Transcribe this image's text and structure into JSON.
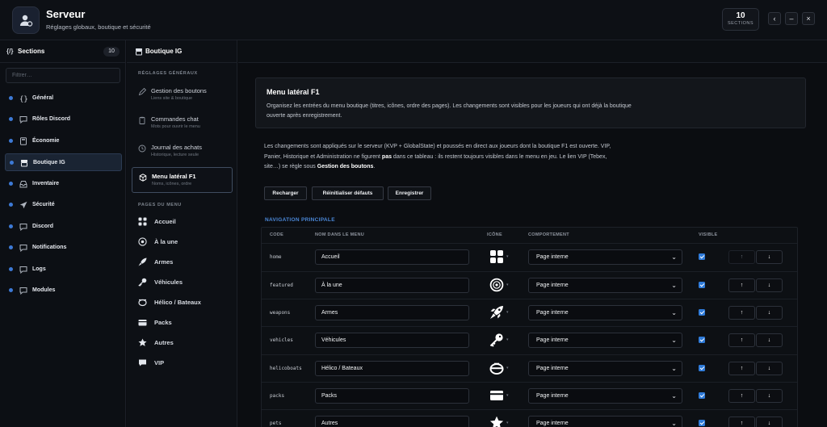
{
  "header": {
    "title": "Serveur",
    "subtitle": "Réglages globaux, boutique et sécurité",
    "count": "10",
    "count_label": "SECTIONS",
    "back_glyph": "‹",
    "minimize_glyph": "–",
    "close_glyph": "×"
  },
  "sidebar": {
    "title": "Sections",
    "badge": "10",
    "filter_placeholder": "Filtrer…",
    "items": [
      {
        "label": "Général",
        "icon": "braces-icon"
      },
      {
        "label": "Rôles Discord",
        "icon": "chat-icon"
      },
      {
        "label": "Économie",
        "icon": "calculator-icon"
      },
      {
        "label": "Boutique IG",
        "icon": "shop-icon"
      },
      {
        "label": "Inventaire",
        "icon": "inbox-icon"
      },
      {
        "label": "Sécurité",
        "icon": "send-icon"
      },
      {
        "label": "Discord",
        "icon": "chat-icon"
      },
      {
        "label": "Notifications",
        "icon": "chat-icon"
      },
      {
        "label": "Logs",
        "icon": "chat-icon"
      },
      {
        "label": "Modules",
        "icon": "chat-icon"
      }
    ],
    "active_index": 3
  },
  "subnav": {
    "title": "Boutique IG",
    "section_general": "RÉGLAGES GÉNÉRAUX",
    "items": [
      {
        "title": "Gestion des boutons",
        "sub": "Liens site & boutique"
      },
      {
        "title": "Commandes chat",
        "sub": "Mots pour ouvrir le menu"
      },
      {
        "title": "Journal des achats",
        "sub": "Historique, lecture seule"
      },
      {
        "title": "Menu latéral F1",
        "sub": "Noms, icônes, ordre"
      }
    ],
    "section_pages": "PAGES DU MENU",
    "pages": [
      {
        "label": "Accueil"
      },
      {
        "label": "À la une"
      },
      {
        "label": "Armes"
      },
      {
        "label": "Véhicules"
      },
      {
        "label": "Hélico / Bateaux"
      },
      {
        "label": "Packs"
      },
      {
        "label": "Autres"
      },
      {
        "label": "VIP"
      }
    ]
  },
  "main": {
    "panel_title": "Menu latéral F1",
    "panel_desc": "Organisez les entrées du menu boutique (titres, icônes, ordre des pages). Les changements sont visibles pour les joueurs qui ont déjà la boutique ouverte après enregistrement.",
    "info_1": "Les changements sont appliqués sur le serveur (KVP + GlobalState) et poussés en direct aux joueurs dont la boutique F1 est ouverte. VIP, Panier, Historique et Administration ne figurent ",
    "info_bold_1": "pas",
    "info_2": " dans ce tableau : ils restent toujours visibles dans le menu en jeu. Le lien VIP (Tebex, site…) se règle sous ",
    "info_bold_2": "Gestion des boutons",
    "info_3": ".",
    "buttons": {
      "reload": "Recharger",
      "reset": "Réinitialiser défauts",
      "save": "Enregistrer"
    },
    "nav_title": "NAVIGATION PRINCIPALE",
    "columns": {
      "code": "CODE",
      "name": "NOM DANS LE MENU",
      "icon": "ICÔNE",
      "behavior": "COMPORTEMENT",
      "visible": "VISIBLE"
    },
    "up_glyph": "↑",
    "down_glyph": "↓",
    "rows": [
      {
        "code": "home",
        "name": "Accueil",
        "icon": "grid-icon",
        "behavior": "Page interne",
        "visible": true
      },
      {
        "code": "featured",
        "name": "À la une",
        "icon": "star-circle-icon",
        "behavior": "Page interne",
        "visible": true
      },
      {
        "code": "weapons",
        "name": "Armes",
        "icon": "rocket-icon",
        "behavior": "Page interne",
        "visible": true
      },
      {
        "code": "vehicles",
        "name": "Véhicules",
        "icon": "key-icon",
        "behavior": "Page interne",
        "visible": true
      },
      {
        "code": "helicoboats",
        "name": "Hélico / Bateaux",
        "icon": "helicopter-icon",
        "behavior": "Page interne",
        "visible": true
      },
      {
        "code": "packs",
        "name": "Packs",
        "icon": "wallet-icon",
        "behavior": "Page interne",
        "visible": true
      },
      {
        "code": "pets",
        "name": "Autres",
        "icon": "star-icon",
        "behavior": "Page interne",
        "visible": true
      }
    ]
  }
}
